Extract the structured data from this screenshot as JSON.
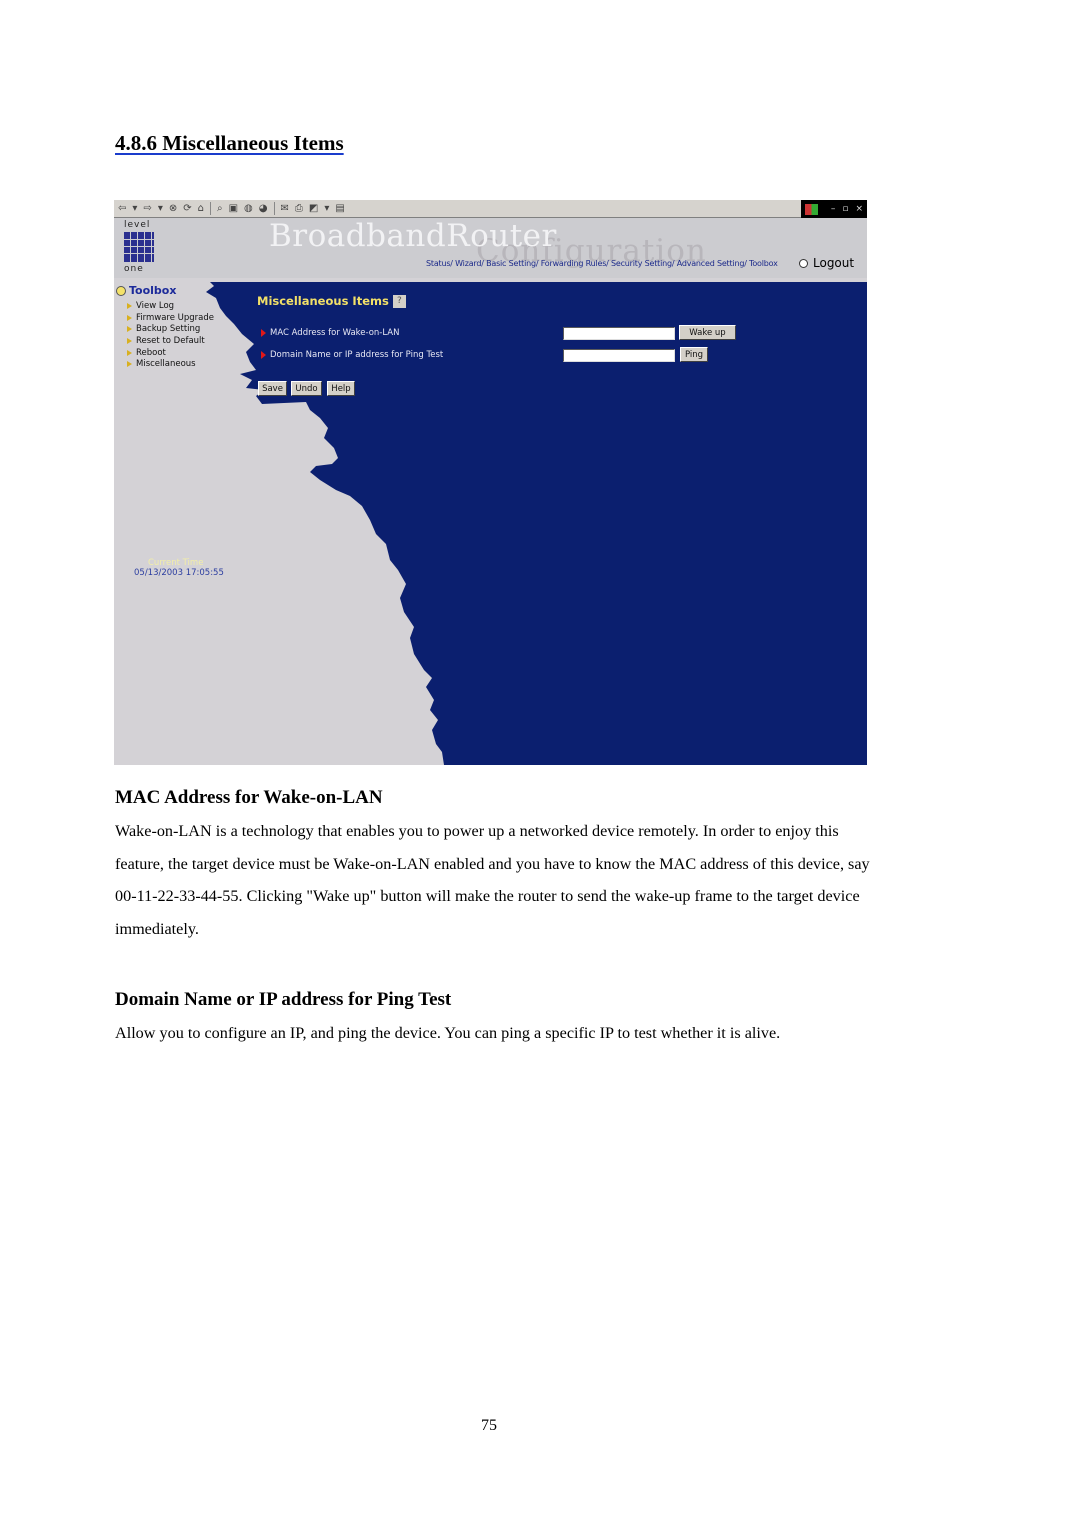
{
  "section_title": "4.8.6 Miscellaneous Items",
  "screenshot": {
    "toolbar_icons": [
      "back-arrow-icon",
      "dropdown-icon",
      "forward-arrow-icon",
      "dropdown-icon",
      "stop-icon",
      "refresh-icon",
      "home-icon",
      "search-icon",
      "favorites-icon",
      "history-icon",
      "media-icon",
      "mail-icon",
      "print-icon",
      "edit-icon",
      "dropdown-icon",
      "discuss-icon"
    ],
    "window_controls": {
      "minimize": "–",
      "restore": "▫",
      "close": "×"
    },
    "brand": {
      "logo_top": "level",
      "logo_bottom": "one",
      "title": "BroadbandRouter",
      "subtitle": "Configuration"
    },
    "top_nav": [
      "Status/",
      "Wizard/",
      "Basic Setting/",
      "Forwarding Rules/",
      "Security Setting/",
      "Advanced Setting/",
      "Toolbox"
    ],
    "logout_label": "Logout",
    "sidebar": {
      "heading": "Toolbox",
      "items": [
        "View Log",
        "Firmware Upgrade",
        "Backup Setting",
        "Reset to Default",
        "Reboot",
        "Miscellaneous"
      ],
      "current_time_label": "Current Time",
      "current_time_value": "05/13/2003 17:05:55"
    },
    "panel": {
      "title": "Miscellaneous Items",
      "help_icon": "?",
      "rows": [
        {
          "label": "MAC Address for Wake-on-LAN",
          "value": "",
          "button": "Wake up"
        },
        {
          "label": "Domain Name or IP address for Ping Test",
          "value": "",
          "button": "Ping"
        }
      ],
      "actions": [
        "Save",
        "Undo",
        "Help"
      ]
    },
    "colors": {
      "panel_blue": "#0b1f6f",
      "sidebar_gray": "#d4d2d6",
      "panel_title_yellow": "#f2e068"
    }
  },
  "sections": [
    {
      "heading": "MAC Address for Wake-on-LAN",
      "body": "Wake-on-LAN is a technology that enables you to power up a networked device remotely. In order to enjoy this feature, the target device must be Wake-on-LAN enabled and you have to know the MAC address of this device, say 00-11-22-33-44-55. Clicking \"Wake up\" button will make the router to send the wake-up frame to the target device immediately."
    },
    {
      "heading": "Domain Name or IP address for Ping Test",
      "body": "Allow you to configure an IP, and ping the device. You can ping a specific IP to test whether it is alive."
    }
  ],
  "page_number": "75"
}
